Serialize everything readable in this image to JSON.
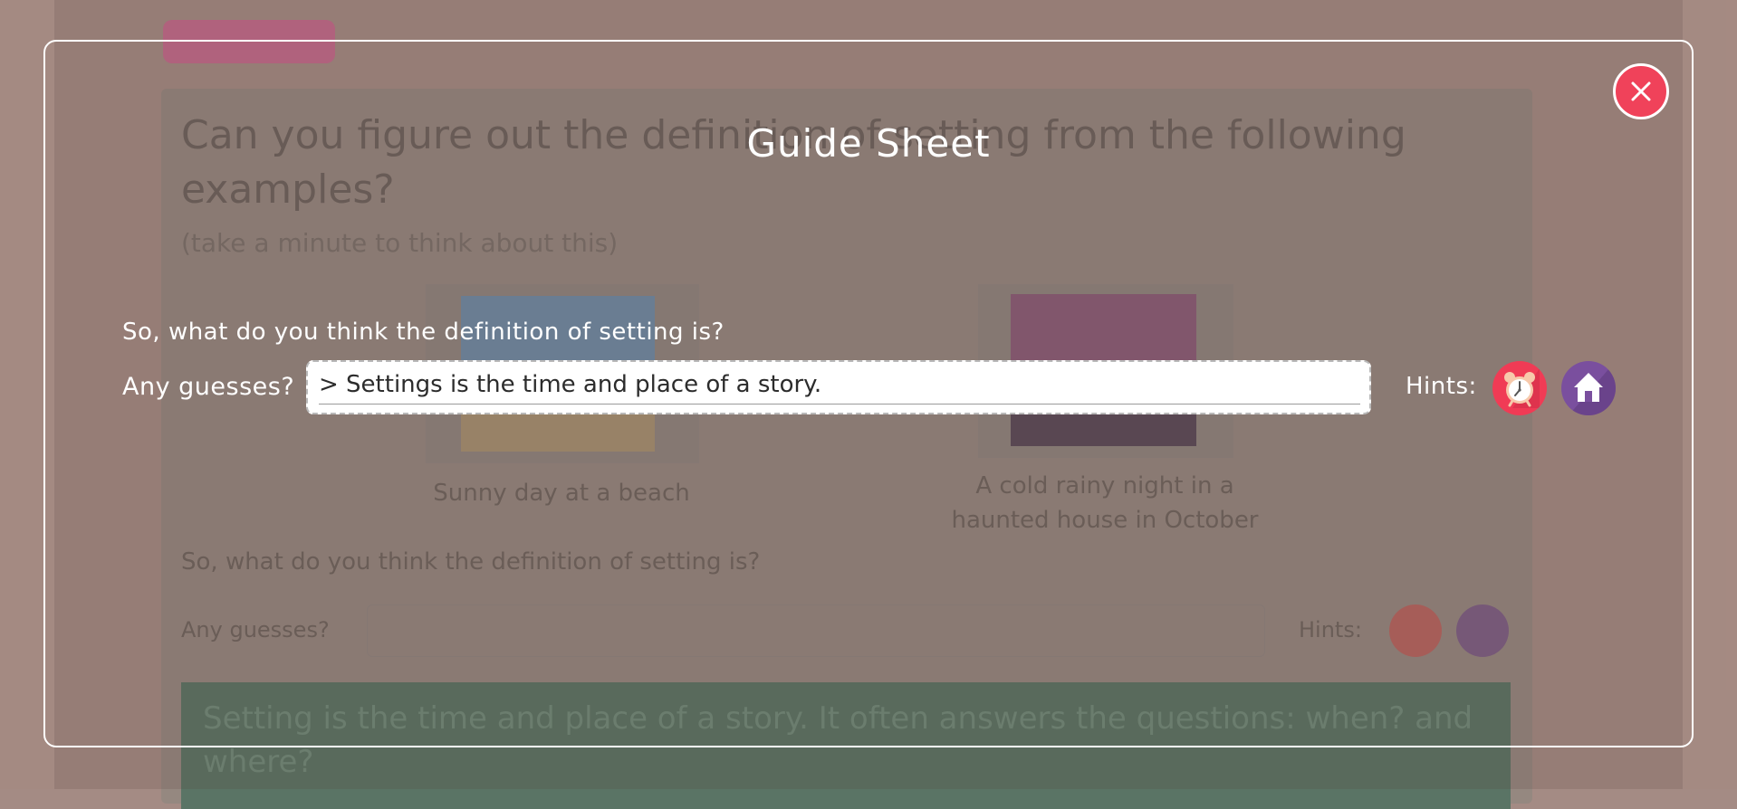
{
  "background": {
    "tab_label": "",
    "heading": "Can you figure out the definition of setting from the following examples?",
    "subheading": "(take a minute to think about this)",
    "caption_1": "Sunny day at a beach",
    "caption_2": "A cold rainy night in a haunted house in October",
    "question": "So, what do you think the definition of setting is?",
    "guess_label": "Any guesses?",
    "hints_label": "Hints:",
    "definition": "Setting is the time and place of a story. It often answers the questions: when? and where?"
  },
  "modal": {
    "title": "Guide Sheet",
    "question": "So, what do you think the definition of setting is?",
    "guess_label": "Any guesses?",
    "answer_value": "> Settings is the time and place of a story.",
    "hints_label": "Hints:",
    "hint_buttons": [
      {
        "icon": "alarm-clock-icon",
        "color": "#f03b55"
      },
      {
        "icon": "house-icon",
        "color": "#7a4f9e"
      }
    ],
    "close_icon": "close-icon",
    "close_color": "#f0425a"
  }
}
